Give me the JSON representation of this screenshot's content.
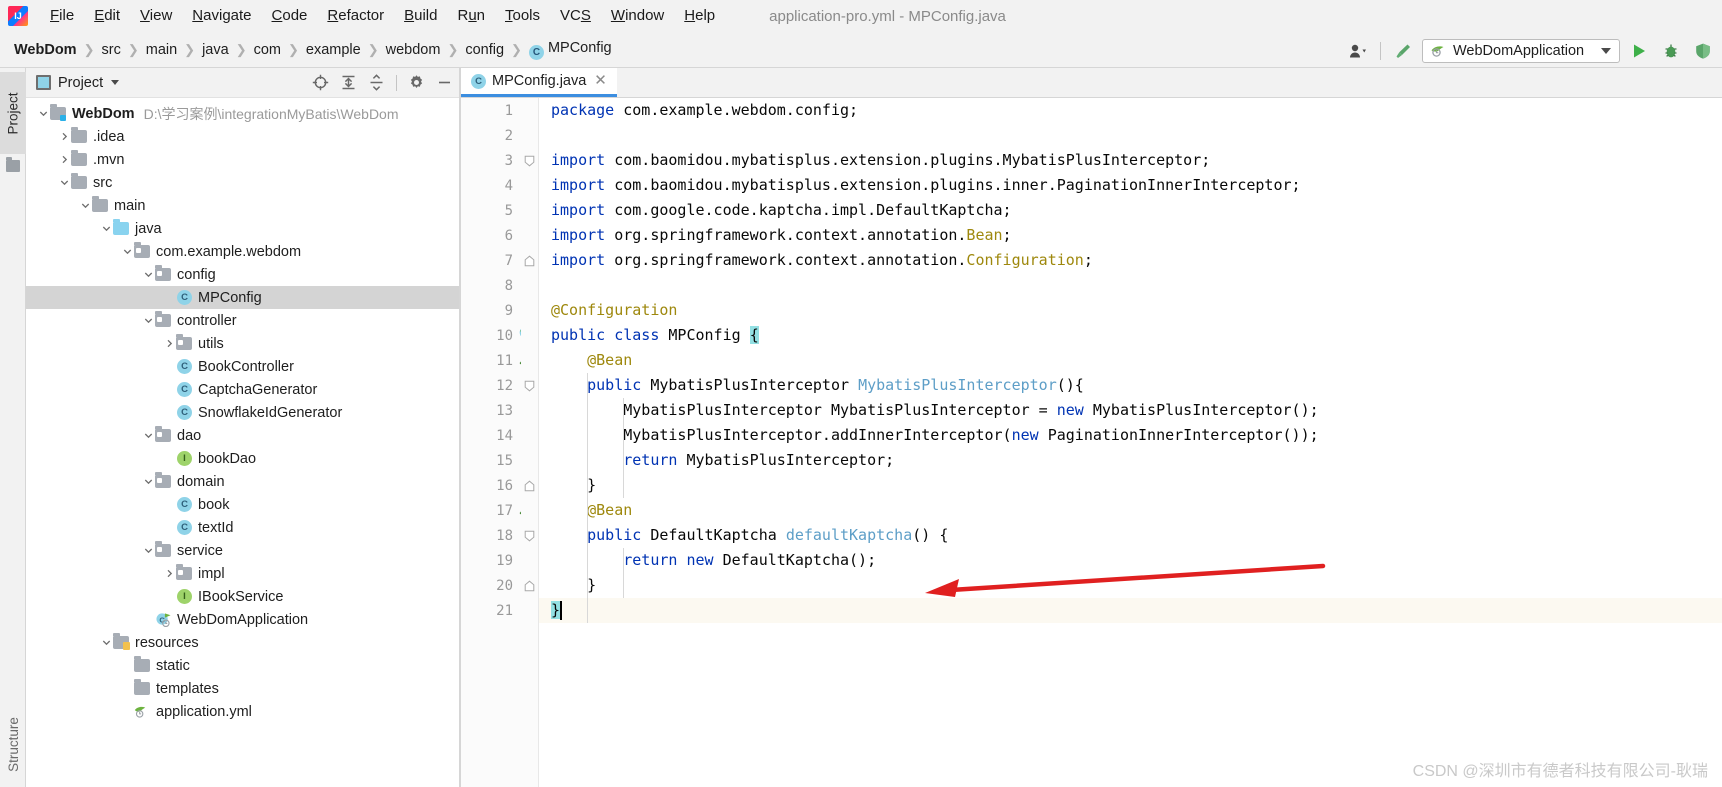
{
  "window": {
    "title": "application-pro.yml - MPConfig.java",
    "logo_icon": "intellij-idea-logo"
  },
  "menubar": {
    "items": [
      {
        "label": "File",
        "mnemonic": "F"
      },
      {
        "label": "Edit",
        "mnemonic": "E"
      },
      {
        "label": "View",
        "mnemonic": "V"
      },
      {
        "label": "Navigate",
        "mnemonic": "N"
      },
      {
        "label": "Code",
        "mnemonic": "C"
      },
      {
        "label": "Refactor",
        "mnemonic": "R"
      },
      {
        "label": "Build",
        "mnemonic": "B"
      },
      {
        "label": "Run",
        "mnemonic": "u"
      },
      {
        "label": "Tools",
        "mnemonic": "T"
      },
      {
        "label": "VCS",
        "mnemonic": "S"
      },
      {
        "label": "Window",
        "mnemonic": "W"
      },
      {
        "label": "Help",
        "mnemonic": "H"
      }
    ]
  },
  "breadcrumb": {
    "items": [
      {
        "label": "WebDom",
        "type": "module"
      },
      {
        "label": "src",
        "type": "folder"
      },
      {
        "label": "main",
        "type": "folder"
      },
      {
        "label": "java",
        "type": "folder"
      },
      {
        "label": "com",
        "type": "folder"
      },
      {
        "label": "example",
        "type": "folder"
      },
      {
        "label": "webdom",
        "type": "folder"
      },
      {
        "label": "config",
        "type": "folder"
      },
      {
        "label": "MPConfig",
        "type": "class",
        "icon": "class-icon",
        "icon_letter": "C"
      }
    ]
  },
  "toolbar": {
    "user_icon": "user-silhouette-icon",
    "hammer_icon": "build-hammer-icon",
    "run_config": {
      "label": "WebDomApplication",
      "icon": "spring-boot-icon"
    },
    "run_icon": "run-triangle-icon",
    "debug_icon": "debug-bug-icon",
    "coverage_icon": "coverage-shield-icon"
  },
  "tool_strip": {
    "project_tab": "Project",
    "structure_tab": "Structure",
    "favorites_icon": "favorites-folder-icon"
  },
  "project_panel": {
    "title": "Project",
    "title_icon": "project-view-icon",
    "dropdown_icon": "chevron-down-icon",
    "actions": [
      {
        "name": "locate-icon",
        "title": "Select Opened File"
      },
      {
        "name": "expand-all-icon",
        "title": "Expand All"
      },
      {
        "name": "collapse-all-icon",
        "title": "Collapse All"
      },
      {
        "name": "gear-icon",
        "title": "Settings"
      },
      {
        "name": "minimize-icon",
        "title": "Hide"
      }
    ],
    "tree": [
      {
        "label": "WebDom",
        "suffix": "D:\\学习案例\\integrationMyBatis\\WebDom",
        "depth": 0,
        "icon": "module-folder-icon",
        "arrow": "expanded",
        "bold": true,
        "selected": false
      },
      {
        "label": ".idea",
        "depth": 1,
        "icon": "folder-icon",
        "arrow": "collapsed",
        "selected": false
      },
      {
        "label": ".mvn",
        "depth": 1,
        "icon": "folder-icon",
        "arrow": "collapsed",
        "selected": false
      },
      {
        "label": "src",
        "depth": 1,
        "icon": "folder-icon",
        "arrow": "expanded",
        "selected": false
      },
      {
        "label": "main",
        "depth": 2,
        "icon": "folder-icon",
        "arrow": "expanded",
        "selected": false
      },
      {
        "label": "java",
        "depth": 3,
        "icon": "source-folder-icon",
        "arrow": "expanded",
        "selected": false
      },
      {
        "label": "com.example.webdom",
        "depth": 4,
        "icon": "package-icon",
        "arrow": "expanded",
        "selected": false
      },
      {
        "label": "config",
        "depth": 5,
        "icon": "package-icon",
        "arrow": "expanded",
        "selected": false
      },
      {
        "label": "MPConfig",
        "depth": 6,
        "icon": "class-icon",
        "icon_letter": "C",
        "arrow": "none",
        "selected": true
      },
      {
        "label": "controller",
        "depth": 5,
        "icon": "package-icon",
        "arrow": "expanded",
        "selected": false
      },
      {
        "label": "utils",
        "depth": 6,
        "icon": "package-icon",
        "arrow": "collapsed",
        "selected": false
      },
      {
        "label": "BookController",
        "depth": 6,
        "icon": "class-icon",
        "icon_letter": "C",
        "arrow": "none",
        "selected": false
      },
      {
        "label": "CaptchaGenerator",
        "depth": 6,
        "icon": "class-icon",
        "icon_letter": "C",
        "arrow": "none",
        "selected": false
      },
      {
        "label": "SnowflakeIdGenerator",
        "depth": 6,
        "icon": "class-icon",
        "icon_letter": "C",
        "arrow": "none",
        "selected": false
      },
      {
        "label": "dao",
        "depth": 5,
        "icon": "package-icon",
        "arrow": "expanded",
        "selected": false
      },
      {
        "label": "bookDao",
        "depth": 6,
        "icon": "interface-icon",
        "icon_letter": "I",
        "arrow": "none",
        "selected": false
      },
      {
        "label": "domain",
        "depth": 5,
        "icon": "package-icon",
        "arrow": "expanded",
        "selected": false
      },
      {
        "label": "book",
        "depth": 6,
        "icon": "class-icon",
        "icon_letter": "C",
        "arrow": "none",
        "selected": false
      },
      {
        "label": "textId",
        "depth": 6,
        "icon": "class-icon",
        "icon_letter": "C",
        "arrow": "none",
        "selected": false
      },
      {
        "label": "service",
        "depth": 5,
        "icon": "package-icon",
        "arrow": "expanded",
        "selected": false
      },
      {
        "label": "impl",
        "depth": 6,
        "icon": "package-icon",
        "arrow": "collapsed",
        "selected": false
      },
      {
        "label": "IBookService",
        "depth": 6,
        "icon": "interface-icon",
        "icon_letter": "I",
        "arrow": "none",
        "selected": false
      },
      {
        "label": "WebDomApplication",
        "depth": 5,
        "icon": "spring-app-class-icon",
        "arrow": "none",
        "selected": false
      },
      {
        "label": "resources",
        "depth": 3,
        "icon": "resources-folder-icon",
        "arrow": "expanded",
        "selected": false
      },
      {
        "label": "static",
        "depth": 4,
        "icon": "folder-icon",
        "arrow": "none",
        "selected": false
      },
      {
        "label": "templates",
        "depth": 4,
        "icon": "folder-icon",
        "arrow": "none",
        "selected": false
      },
      {
        "label": "application.yml",
        "depth": 4,
        "icon": "spring-yaml-icon",
        "arrow": "none",
        "selected": false
      }
    ]
  },
  "editor": {
    "tabs": [
      {
        "label": "MPConfig.java",
        "icon": "class-icon",
        "icon_letter": "C",
        "active": true,
        "close_icon": "close-icon"
      }
    ],
    "current_line": 21,
    "lines": [
      {
        "n": 1,
        "gutter_icon": null,
        "fold": null,
        "tokens": [
          {
            "t": "package ",
            "c": "kw"
          },
          {
            "t": "com.example.webdom.config;",
            "c": ""
          }
        ]
      },
      {
        "n": 2,
        "gutter_icon": null,
        "fold": null,
        "tokens": []
      },
      {
        "n": 3,
        "gutter_icon": null,
        "fold": "start",
        "tokens": [
          {
            "t": "import ",
            "c": "kw"
          },
          {
            "t": "com.baomidou.mybatisplus.extension.plugins.MybatisPlusInterceptor;",
            "c": ""
          }
        ]
      },
      {
        "n": 4,
        "gutter_icon": null,
        "fold": null,
        "tokens": [
          {
            "t": "import ",
            "c": "kw"
          },
          {
            "t": "com.baomidou.mybatisplus.extension.plugins.inner.PaginationInnerInterceptor;",
            "c": ""
          }
        ]
      },
      {
        "n": 5,
        "gutter_icon": null,
        "fold": null,
        "tokens": [
          {
            "t": "import ",
            "c": "kw"
          },
          {
            "t": "com.google.code.kaptcha.impl.DefaultKaptcha;",
            "c": ""
          }
        ]
      },
      {
        "n": 6,
        "gutter_icon": null,
        "fold": null,
        "tokens": [
          {
            "t": "import ",
            "c": "kw"
          },
          {
            "t": "org.springframework.context.annotation.",
            "c": ""
          },
          {
            "t": "Bean",
            "c": "ann"
          },
          {
            "t": ";",
            "c": ""
          }
        ]
      },
      {
        "n": 7,
        "gutter_icon": null,
        "fold": "end",
        "tokens": [
          {
            "t": "import ",
            "c": "kw"
          },
          {
            "t": "org.springframework.context.annotation.",
            "c": ""
          },
          {
            "t": "Configuration",
            "c": "ann"
          },
          {
            "t": ";",
            "c": ""
          }
        ]
      },
      {
        "n": 8,
        "gutter_icon": null,
        "fold": null,
        "tokens": []
      },
      {
        "n": 9,
        "gutter_icon": null,
        "fold": null,
        "tokens": [
          {
            "t": "@Configuration",
            "c": "ann"
          }
        ]
      },
      {
        "n": 10,
        "gutter_icon": "spring-bean-gutter-icon",
        "fold": null,
        "tokens": [
          {
            "t": "public class ",
            "c": "kw"
          },
          {
            "t": "MPConfig ",
            "c": ""
          },
          {
            "t": "{",
            "c": "brmatch"
          }
        ]
      },
      {
        "n": 11,
        "gutter_icon": "bean-arrow-gutter-icon",
        "fold": null,
        "tokens": [
          {
            "t": "    @Bean",
            "c": "ann"
          }
        ]
      },
      {
        "n": 12,
        "gutter_icon": null,
        "fold": "start",
        "tokens": [
          {
            "t": "    ",
            "c": ""
          },
          {
            "t": "public ",
            "c": "kw"
          },
          {
            "t": "MybatisPlusInterceptor ",
            "c": ""
          },
          {
            "t": "MybatisPlusInterceptor",
            "c": "meth"
          },
          {
            "t": "(){",
            "c": ""
          }
        ]
      },
      {
        "n": 13,
        "gutter_icon": null,
        "fold": null,
        "tokens": [
          {
            "t": "        MybatisPlusInterceptor MybatisPlusInterceptor = ",
            "c": ""
          },
          {
            "t": "new ",
            "c": "kw"
          },
          {
            "t": "MybatisPlusInterceptor();",
            "c": ""
          }
        ]
      },
      {
        "n": 14,
        "gutter_icon": null,
        "fold": null,
        "tokens": [
          {
            "t": "        MybatisPlusInterceptor.addInnerInterceptor(",
            "c": ""
          },
          {
            "t": "new ",
            "c": "kw"
          },
          {
            "t": "PaginationInnerInterceptor());",
            "c": ""
          }
        ]
      },
      {
        "n": 15,
        "gutter_icon": null,
        "fold": null,
        "tokens": [
          {
            "t": "        ",
            "c": ""
          },
          {
            "t": "return ",
            "c": "kw"
          },
          {
            "t": "MybatisPlusInterceptor;",
            "c": ""
          }
        ]
      },
      {
        "n": 16,
        "gutter_icon": null,
        "fold": "end",
        "tokens": [
          {
            "t": "    }",
            "c": ""
          }
        ]
      },
      {
        "n": 17,
        "gutter_icon": "bean-arrow-gutter-icon",
        "fold": null,
        "tokens": [
          {
            "t": "    @Bean",
            "c": "ann"
          }
        ]
      },
      {
        "n": 18,
        "gutter_icon": null,
        "fold": "start",
        "tokens": [
          {
            "t": "    ",
            "c": ""
          },
          {
            "t": "public ",
            "c": "kw"
          },
          {
            "t": "DefaultKaptcha ",
            "c": ""
          },
          {
            "t": "defaultKaptcha",
            "c": "meth"
          },
          {
            "t": "() {",
            "c": ""
          }
        ]
      },
      {
        "n": 19,
        "gutter_icon": null,
        "fold": null,
        "tokens": [
          {
            "t": "        ",
            "c": ""
          },
          {
            "t": "return new ",
            "c": "kw"
          },
          {
            "t": "DefaultKaptcha();",
            "c": ""
          }
        ]
      },
      {
        "n": 20,
        "gutter_icon": null,
        "fold": "end",
        "tokens": [
          {
            "t": "    }",
            "c": ""
          }
        ]
      },
      {
        "n": 21,
        "gutter_icon": null,
        "fold": null,
        "tokens": [
          {
            "t": "}",
            "c": "brmatch"
          }
        ]
      }
    ]
  },
  "annotation": {
    "arrow_icon": "red-arrow-pointing-left",
    "arrow_color": "#e02020"
  },
  "watermark": {
    "text": "CSDN @深圳市有德者科技有限公司-耿瑞"
  },
  "colors": {
    "accent_blue": "#3c8ee0",
    "keyword": "#0033b3",
    "annotation": "#9e880d",
    "method": "#5d9ec7",
    "selection_gray": "#d4d4d4",
    "current_line": "#fcf9f1",
    "bracket_match": "#93e0e3",
    "chrome_bg": "#f2f2f2"
  }
}
